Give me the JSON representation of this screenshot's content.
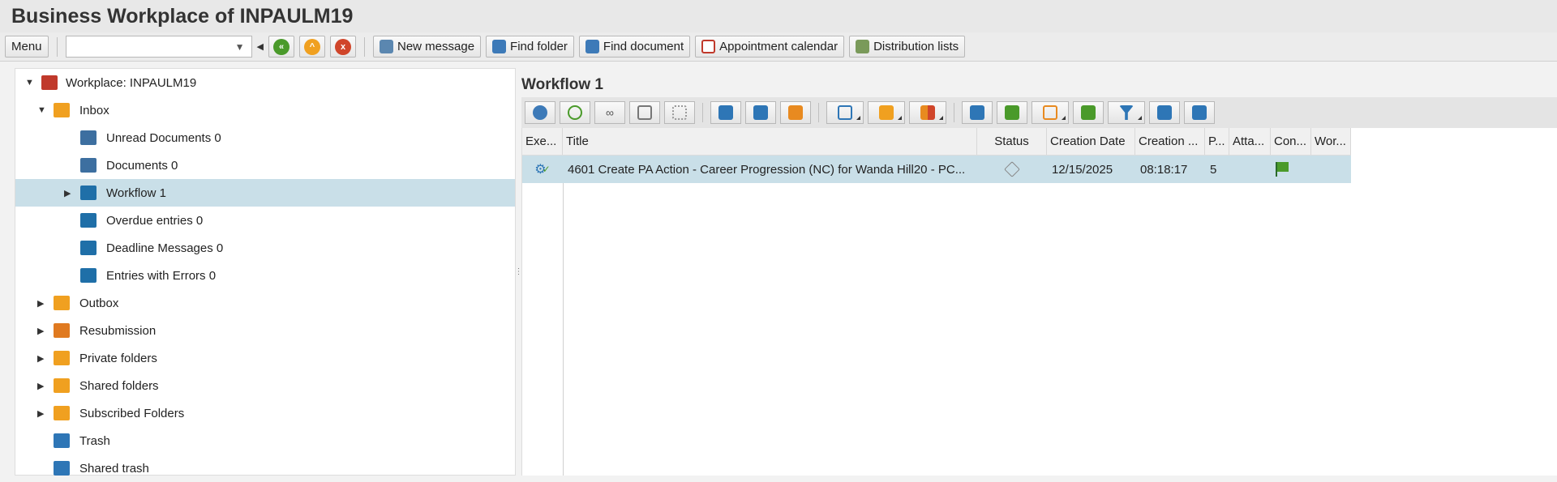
{
  "window": {
    "title": "Business Workplace of INPAULM19"
  },
  "toolbar": {
    "menu": "Menu",
    "command_value": "",
    "new_message": "New message",
    "find_folder": "Find folder",
    "find_document": "Find document",
    "appointment_calendar": "Appointment calendar",
    "distribution_lists": "Distribution lists"
  },
  "tree": [
    {
      "label": "Workplace: INPAULM19",
      "level": 0,
      "expander": "expanded",
      "icon": "workplace-icon"
    },
    {
      "label": "Inbox",
      "level": 1,
      "expander": "expanded",
      "icon": "inbox-icon"
    },
    {
      "label": "Unread Documents 0",
      "level": 2,
      "expander": "",
      "icon": "document-list-icon"
    },
    {
      "label": "Documents 0",
      "level": 2,
      "expander": "",
      "icon": "document-list-icon"
    },
    {
      "label": "Workflow 1",
      "level": 2,
      "expander": "collapsed",
      "icon": "workflow-icon",
      "selected": true
    },
    {
      "label": "Overdue entries 0",
      "level": 2,
      "expander": "",
      "icon": "workflow-icon"
    },
    {
      "label": "Deadline Messages 0",
      "level": 2,
      "expander": "",
      "icon": "workflow-icon"
    },
    {
      "label": "Entries with Errors 0",
      "level": 2,
      "expander": "",
      "icon": "workflow-icon"
    },
    {
      "label": "Outbox",
      "level": 1,
      "expander": "collapsed",
      "icon": "outbox-icon"
    },
    {
      "label": "Resubmission",
      "level": 1,
      "expander": "collapsed",
      "icon": "resubmission-icon"
    },
    {
      "label": "Private folders",
      "level": 1,
      "expander": "collapsed",
      "icon": "private-folder-icon"
    },
    {
      "label": "Shared folders",
      "level": 1,
      "expander": "collapsed",
      "icon": "shared-folder-icon"
    },
    {
      "label": "Subscribed Folders",
      "level": 1,
      "expander": "collapsed",
      "icon": "subscribed-folder-icon"
    },
    {
      "label": "Trash",
      "level": 1,
      "expander": "",
      "icon": "trash-icon"
    },
    {
      "label": "Shared trash",
      "level": 1,
      "expander": "",
      "icon": "trash-icon"
    }
  ],
  "main": {
    "title": "Workflow 1",
    "columns": [
      "Exe...",
      "Title",
      "Status",
      "Creation Date",
      "Creation ...",
      "P...",
      "Atta...",
      "Con...",
      "Wor..."
    ],
    "rows": [
      {
        "title": "4601 Create PA Action - Career Progression (NC) for Wanda Hill20 - PC...",
        "creation_date": "12/15/2025",
        "creation_time": "08:18:17",
        "priority": "5"
      }
    ]
  },
  "colors": {
    "selection": "#c9dfe8",
    "accent": "#1f6fa8"
  }
}
